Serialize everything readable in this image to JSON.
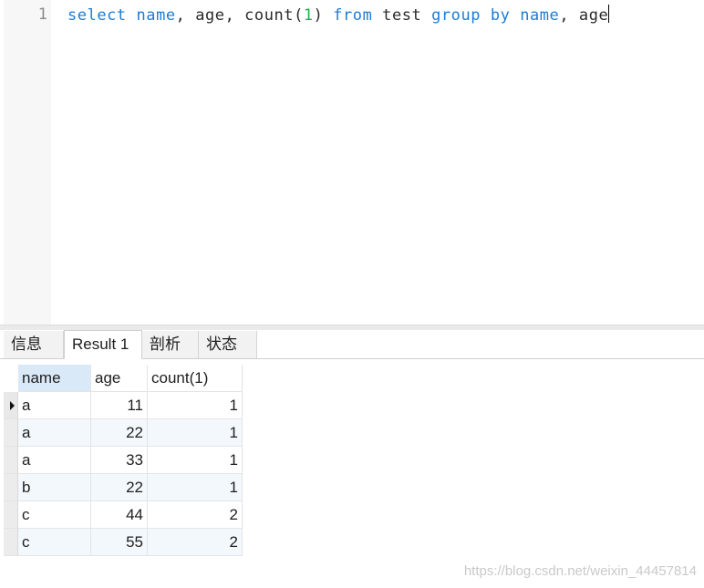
{
  "editor": {
    "line_number": "1",
    "tokens": [
      {
        "text": "select",
        "kind": "kw"
      },
      {
        "text": " ",
        "kind": "id"
      },
      {
        "text": "name",
        "kind": "kw"
      },
      {
        "text": ", age, count(",
        "kind": "id"
      },
      {
        "text": "1",
        "kind": "num"
      },
      {
        "text": ") ",
        "kind": "id"
      },
      {
        "text": "from",
        "kind": "kw"
      },
      {
        "text": " test ",
        "kind": "id"
      },
      {
        "text": "group",
        "kind": "kw"
      },
      {
        "text": " ",
        "kind": "id"
      },
      {
        "text": "by",
        "kind": "kw"
      },
      {
        "text": " ",
        "kind": "id"
      },
      {
        "text": "name",
        "kind": "kw"
      },
      {
        "text": ", age",
        "kind": "id"
      }
    ]
  },
  "tabs": [
    {
      "label": "信息",
      "active": false
    },
    {
      "label": "Result 1",
      "active": true
    },
    {
      "label": "剖析",
      "active": false
    },
    {
      "label": "状态",
      "active": false
    }
  ],
  "result": {
    "columns": [
      "name",
      "age",
      "count(1)"
    ],
    "rows": [
      [
        "a",
        "11",
        "1"
      ],
      [
        "a",
        "22",
        "1"
      ],
      [
        "a",
        "33",
        "1"
      ],
      [
        "b",
        "22",
        "1"
      ],
      [
        "c",
        "44",
        "2"
      ],
      [
        "c",
        "55",
        "2"
      ]
    ],
    "current_row": 0
  },
  "watermark": "https://blog.csdn.net/weixin_44457814",
  "colors": {
    "keyword": "#1a7cd8",
    "number": "#1cb24a",
    "header_selected": "#d9e9f7"
  },
  "icons": {
    "row_indicator": "current-row-arrow-icon"
  }
}
